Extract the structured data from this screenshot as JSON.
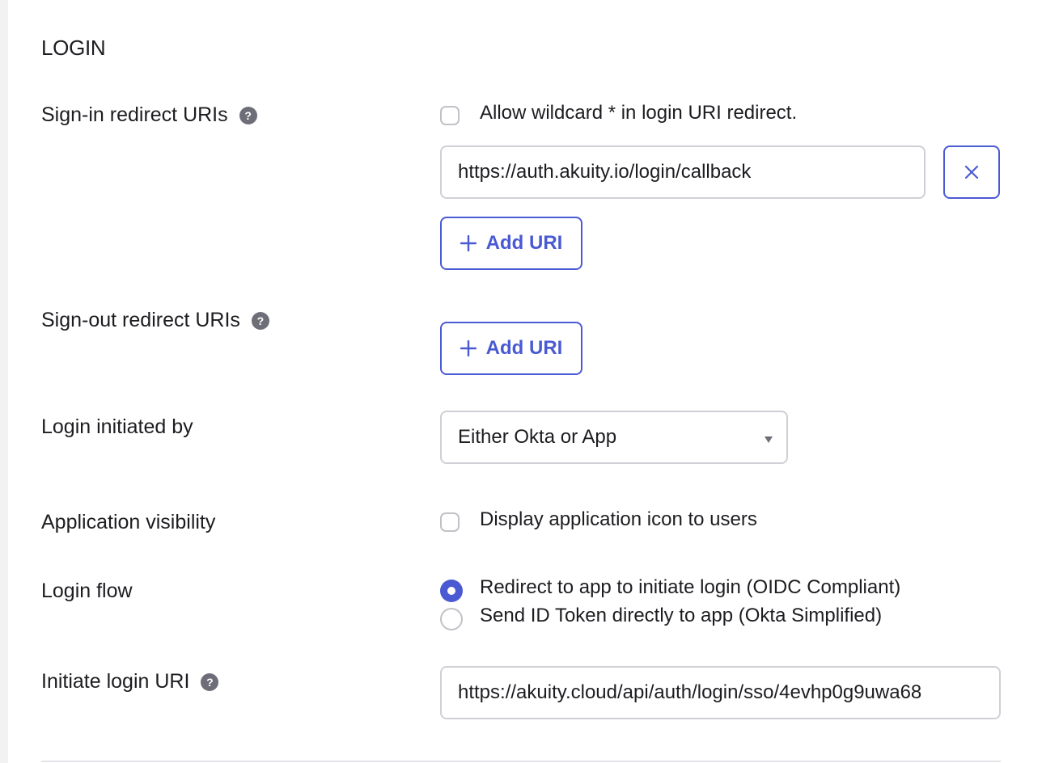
{
  "section": {
    "title": "LOGIN"
  },
  "sign_in": {
    "label": "Sign-in redirect URIs",
    "wildcard_label": "Allow wildcard * in login URI redirect.",
    "uri_value": "https://auth.akuity.io/login/callback",
    "add_label": "Add URI"
  },
  "sign_out": {
    "label": "Sign-out redirect URIs",
    "add_label": "Add URI"
  },
  "login_initiated": {
    "label": "Login initiated by",
    "selected": "Either Okta or App"
  },
  "visibility": {
    "label": "Application visibility",
    "option_label": "Display application icon to users"
  },
  "login_flow": {
    "label": "Login flow",
    "options": [
      {
        "label": "Redirect to app to initiate login (OIDC Compliant)",
        "selected": true
      },
      {
        "label": "Send ID Token directly to app (Okta Simplified)",
        "selected": false
      }
    ]
  },
  "initiate_uri": {
    "label": "Initiate login URI",
    "value": "https://akuity.cloud/api/auth/login/sso/4evhp0g9uwa68"
  },
  "colors": {
    "accent": "#4a5ad2",
    "help_icon": "#6e6e78",
    "border": "#cfcfd6"
  }
}
